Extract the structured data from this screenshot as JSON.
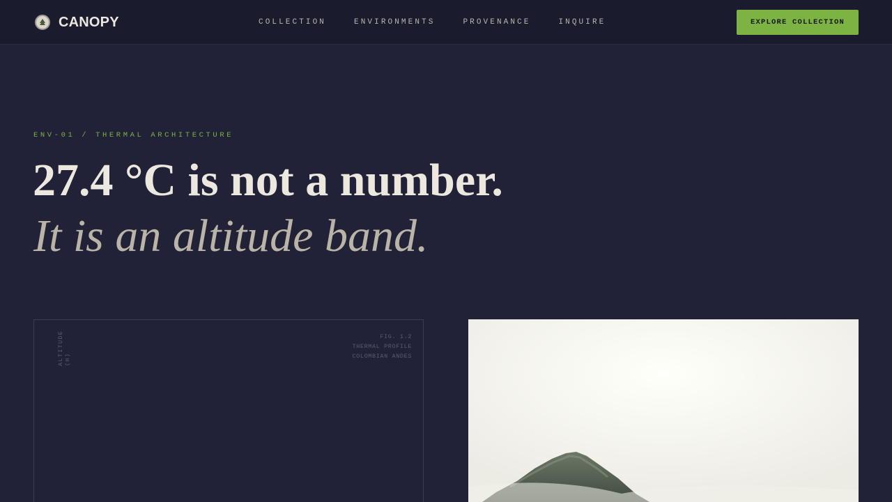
{
  "header": {
    "brand": "CANOPY",
    "brand_icon": "leaf-seal-icon",
    "nav": [
      "COLLECTION",
      "ENVIRONMENTS",
      "PROVENANCE",
      "INQUIRE"
    ],
    "cta_label": "EXPLORE COLLECTION"
  },
  "hero": {
    "eyebrow": "ENV-01 / THERMAL ARCHITECTURE",
    "headline": "27.4 °C is not a number.",
    "subline": "It is an altitude band."
  },
  "figure": {
    "axis_label": "ALTITUDE (m)",
    "caption": [
      "FIG. 1.2",
      "THERMAL PROFILE",
      "COLOMBIAN ANDES"
    ]
  },
  "photo": {
    "subject": "misty forested mountain peak"
  },
  "colors": {
    "background": "#212237",
    "header_bg": "#1b1b2e",
    "accent": "#7cb342",
    "text": "#ece8e0",
    "muted_text": "#bab3a8"
  }
}
